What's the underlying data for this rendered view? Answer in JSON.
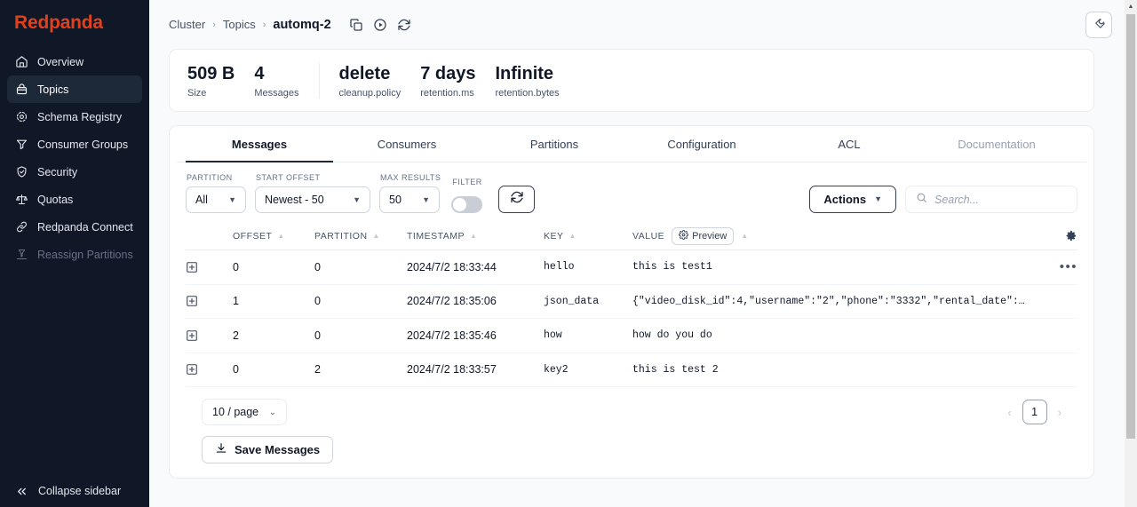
{
  "sidebar": {
    "brand": "Redpanda",
    "items": [
      {
        "label": "Overview",
        "icon": "home-icon",
        "active": false,
        "dim": false
      },
      {
        "label": "Topics",
        "icon": "topics-icon",
        "active": true,
        "dim": false
      },
      {
        "label": "Schema Registry",
        "icon": "schema-registry-icon",
        "active": false,
        "dim": false
      },
      {
        "label": "Consumer Groups",
        "icon": "consumer-groups-icon",
        "active": false,
        "dim": false
      },
      {
        "label": "Security",
        "icon": "shield-icon",
        "active": false,
        "dim": false
      },
      {
        "label": "Quotas",
        "icon": "scales-icon",
        "active": false,
        "dim": false
      },
      {
        "label": "Redpanda Connect",
        "icon": "link-icon",
        "active": false,
        "dim": false
      },
      {
        "label": "Reassign Partitions",
        "icon": "reassign-icon",
        "active": false,
        "dim": true
      }
    ],
    "collapse_label": "Collapse sidebar"
  },
  "breadcrumb": {
    "items": [
      "Cluster",
      "Topics"
    ],
    "current": "automq-2",
    "separator": "›",
    "actions": [
      "copy-icon",
      "play-circle-icon",
      "refresh-icon"
    ]
  },
  "topbar": {
    "tool_button_icon": "wrench-icon"
  },
  "stats": [
    {
      "value": "509 B",
      "label": "Size",
      "divider": false
    },
    {
      "value": "4",
      "label": "Messages",
      "divider": false
    },
    {
      "value": "delete",
      "label": "cleanup.policy",
      "divider": true
    },
    {
      "value": "7 days",
      "label": "retention.ms",
      "divider": false
    },
    {
      "value": "Infinite",
      "label": "retention.bytes",
      "divider": false
    }
  ],
  "tabs": [
    {
      "label": "Messages",
      "active": true,
      "disabled": false
    },
    {
      "label": "Consumers",
      "active": false,
      "disabled": false
    },
    {
      "label": "Partitions",
      "active": false,
      "disabled": false
    },
    {
      "label": "Configuration",
      "active": false,
      "disabled": false
    },
    {
      "label": "ACL",
      "active": false,
      "disabled": false
    },
    {
      "label": "Documentation",
      "active": false,
      "disabled": true
    }
  ],
  "filters": {
    "partition": {
      "label": "Partition",
      "value": "All"
    },
    "start_offset": {
      "label": "Start Offset",
      "value": "Newest - 50"
    },
    "max_results": {
      "label": "Max Results",
      "value": "50"
    },
    "filter_toggle": {
      "label": "Filter",
      "on": false
    },
    "refresh_icon": "refresh-icon",
    "actions_label": "Actions",
    "search_placeholder": "Search..."
  },
  "table": {
    "columns": {
      "offset": "Offset",
      "partition": "Partition",
      "timestamp": "Timestamp",
      "key": "Key",
      "value": "Value"
    },
    "preview_label": "Preview",
    "settings_icon": "gear-icon",
    "rows": [
      {
        "offset": "0",
        "partition": "0",
        "timestamp": "2024/7/2 18:33:44",
        "key": "hello",
        "value": "this is test1",
        "menu": true
      },
      {
        "offset": "1",
        "partition": "0",
        "timestamp": "2024/7/2 18:35:06",
        "key": "json_data",
        "value": "{\"video_disk_id\":4,\"username\":\"2\",\"phone\":\"3332\",\"rental_date\":…",
        "menu": false
      },
      {
        "offset": "2",
        "partition": "0",
        "timestamp": "2024/7/2 18:35:46",
        "key": "how",
        "value": "how do you do",
        "menu": false
      },
      {
        "offset": "0",
        "partition": "2",
        "timestamp": "2024/7/2 18:33:57",
        "key": "key2",
        "value": "this is test 2",
        "menu": false
      }
    ]
  },
  "footer": {
    "page_size": "10 / page",
    "prev": "‹",
    "next": "›",
    "current_page": "1",
    "save_label": "Save Messages"
  },
  "colors": {
    "brand": "#E2401B",
    "sidebar_bg": "#101828",
    "sidebar_active": "#1D2939",
    "page_bg": "#F9FAFB",
    "card_bg": "#FFFFFF",
    "border": "#EAECF0",
    "text_primary": "#101828",
    "text_muted": "#475467",
    "text_disabled": "#98A2B3"
  }
}
